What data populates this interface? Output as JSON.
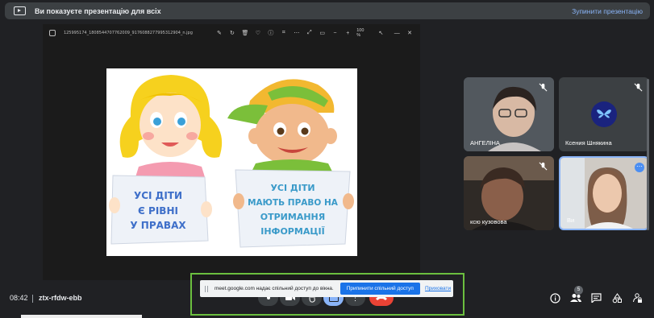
{
  "banner": {
    "message": "Ви показуєте презентацію для всіх",
    "stop_label": "Зупинити презентацію"
  },
  "viewer": {
    "filename": "125995174_1808544707762009_9176088277995312904_n.jpg",
    "zoom": "100 %"
  },
  "picture": {
    "left_sign": [
      "УСІ ДІТИ",
      "Є РІВНІ",
      "У ПРАВАХ"
    ],
    "right_sign": [
      "УСІ ДІТИ",
      "МАЮТЬ ПРАВО НА",
      "ОТРИМАННЯ",
      "ІНФОРМАЦІЇ"
    ]
  },
  "participants": [
    {
      "name": "АНГЕЛІНА",
      "muted": true
    },
    {
      "name": "Ксения Шнякина",
      "muted": true
    },
    {
      "name": "ксю кузовова",
      "muted": true
    },
    {
      "name": "Ви",
      "muted": false
    }
  ],
  "meeting": {
    "time": "08:42",
    "code": "ztx-rfdw-ebb",
    "people_count": "5"
  },
  "share_popup": {
    "text": "meet.google.com надає спільний доступ до вікна.",
    "stop_button": "Припинити спільний доступ",
    "hide_link": "Приховати"
  },
  "colors": {
    "background": "#202124",
    "accent": "#8ab4f8",
    "end_call": "#ea4335",
    "popup_border": "#6bbf3f"
  }
}
